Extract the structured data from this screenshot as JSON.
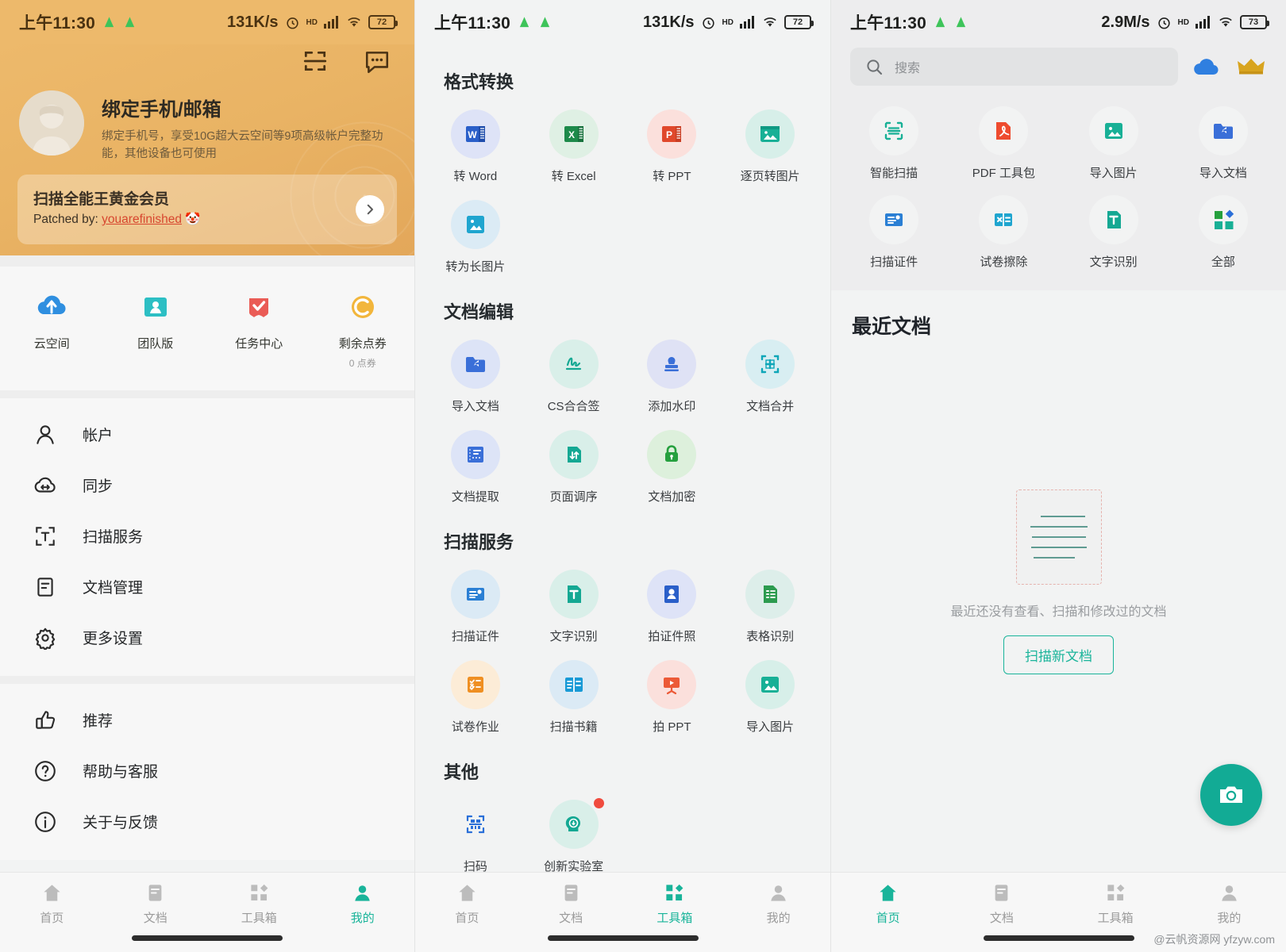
{
  "status_bars": [
    {
      "time": "上午11:30",
      "net_speed": "131K/s",
      "battery": "72",
      "hd": "HD"
    },
    {
      "time": "上午11:30",
      "net_speed": "131K/s",
      "battery": "72",
      "hd": "HD"
    },
    {
      "time": "上午11:30",
      "net_speed": "2.9M/s",
      "battery": "73",
      "hd": "HD"
    }
  ],
  "profile": {
    "scan_icon": "scan-icon",
    "message_icon": "message-icon",
    "name": "绑定手机/邮箱",
    "desc": "绑定手机号，享受10G超大云空间等9项高级帐户完整功能，其他设备也可使用",
    "vip_title": "扫描全能王黄金会员",
    "vip_sub_prefix": "Patched by: ",
    "vip_sub_link": "youarefinished",
    "vip_sub_emoji": "🤡",
    "vip_arrow_icon": "chevron-right-icon",
    "quick": [
      {
        "label": "云空间",
        "icon": "cloud-upload-icon",
        "sub": ""
      },
      {
        "label": "团队版",
        "icon": "team-folder-icon",
        "sub": ""
      },
      {
        "label": "任务中心",
        "icon": "task-check-icon",
        "sub": ""
      },
      {
        "label": "剩余点券",
        "icon": "coin-icon",
        "sub": "0 点券"
      }
    ],
    "menu_group_1": [
      {
        "label": "帐户",
        "icon": "user-icon"
      },
      {
        "label": "同步",
        "icon": "sync-cloud-icon"
      },
      {
        "label": "扫描服务",
        "icon": "scan-text-icon"
      },
      {
        "label": "文档管理",
        "icon": "document-icon"
      },
      {
        "label": "更多设置",
        "icon": "gear-icon"
      }
    ],
    "menu_group_2": [
      {
        "label": "推荐",
        "icon": "thumbs-up-icon"
      },
      {
        "label": "帮助与客服",
        "icon": "question-circle-icon"
      },
      {
        "label": "关于与反馈",
        "icon": "info-circle-icon"
      }
    ]
  },
  "toolbox": {
    "sections": [
      {
        "title": "格式转换",
        "items": [
          {
            "label": "转 Word",
            "icon": "word-icon",
            "bubble": "#dee3f7",
            "badge": false
          },
          {
            "label": "转 Excel",
            "icon": "excel-icon",
            "bubble": "#dff0e4",
            "badge": false
          },
          {
            "label": "转 PPT",
            "icon": "ppt-icon",
            "bubble": "#fbe0dc",
            "badge": false
          },
          {
            "label": "逐页转图片",
            "icon": "image-page-icon",
            "bubble": "#d7efe9",
            "badge": false
          },
          {
            "label": "转为长图片",
            "icon": "long-image-icon",
            "bubble": "#dbebf5",
            "badge": false
          }
        ]
      },
      {
        "title": "文档编辑",
        "items": [
          {
            "label": "导入文档",
            "icon": "import-doc-icon",
            "bubble": "#dde4f7",
            "badge": false
          },
          {
            "label": "CS合合签",
            "icon": "signature-icon",
            "bubble": "#d9efe9",
            "badge": false
          },
          {
            "label": "添加水印",
            "icon": "stamp-icon",
            "bubble": "#dfe2f5",
            "badge": false
          },
          {
            "label": "文档合并",
            "icon": "merge-doc-icon",
            "bubble": "#d8eef2",
            "badge": false
          },
          {
            "label": "文档提取",
            "icon": "extract-doc-icon",
            "bubble": "#dde4f7",
            "badge": false
          },
          {
            "label": "页面调序",
            "icon": "reorder-page-icon",
            "bubble": "#d9efe9",
            "badge": false
          },
          {
            "label": "文档加密",
            "icon": "lock-icon",
            "bubble": "#ddf0dc",
            "badge": false
          }
        ]
      },
      {
        "title": "扫描服务",
        "items": [
          {
            "label": "扫描证件",
            "icon": "id-card-icon",
            "bubble": "#dbeaf5",
            "badge": false
          },
          {
            "label": "文字识别",
            "icon": "ocr-text-icon",
            "bubble": "#d9efe9",
            "badge": false
          },
          {
            "label": "拍证件照",
            "icon": "id-photo-icon",
            "bubble": "#dee3f7",
            "badge": false
          },
          {
            "label": "表格识别",
            "icon": "table-icon",
            "bubble": "#ddeeea",
            "badge": false
          },
          {
            "label": "试卷作业",
            "icon": "exam-icon",
            "bubble": "#fcecd7",
            "badge": false
          },
          {
            "label": "扫描书籍",
            "icon": "book-scan-icon",
            "bubble": "#dbeaf5",
            "badge": false
          },
          {
            "label": "拍 PPT",
            "icon": "ppt-camera-icon",
            "bubble": "#fbe0dc",
            "badge": false
          },
          {
            "label": "导入图片",
            "icon": "import-image-icon",
            "bubble": "#d7efe9",
            "badge": false
          }
        ]
      },
      {
        "title": "其他",
        "items": [
          {
            "label": "扫码",
            "icon": "qrcode-icon",
            "bubble": "transparent",
            "badge": false
          },
          {
            "label": "创新实验室",
            "icon": "lab-brain-icon",
            "bubble": "#d9efe9",
            "badge": true
          }
        ]
      }
    ]
  },
  "home": {
    "search": {
      "placeholder": "搜索",
      "icon": "search-icon"
    },
    "cloud_icon": "cloud-icon",
    "crown_icon": "crown-icon",
    "shortcuts": [
      {
        "label": "智能扫描",
        "icon": "smart-scan-icon"
      },
      {
        "label": "PDF 工具包",
        "icon": "pdf-icon"
      },
      {
        "label": "导入图片",
        "icon": "import-image-icon"
      },
      {
        "label": "导入文档",
        "icon": "import-doc-icon"
      },
      {
        "label": "扫描证件",
        "icon": "id-card-icon"
      },
      {
        "label": "试卷擦除",
        "icon": "exam-erase-icon"
      },
      {
        "label": "文字识别",
        "icon": "ocr-text-icon"
      },
      {
        "label": "全部",
        "icon": "all-grid-icon"
      }
    ],
    "recent_title": "最近文档",
    "empty_text": "最近还没有查看、扫描和修改过的文档",
    "scan_button": "扫描新文档",
    "fab_icon": "camera-icon",
    "watermark": "@云帆资源网 yfzyw.com"
  },
  "tabbars": [
    {
      "active": 3,
      "items": [
        {
          "label": "首页",
          "icon": "home-icon"
        },
        {
          "label": "文档",
          "icon": "document-icon"
        },
        {
          "label": "工具箱",
          "icon": "toolbox-icon"
        },
        {
          "label": "我的",
          "icon": "profile-icon"
        }
      ]
    },
    {
      "active": 2,
      "items": [
        {
          "label": "首页",
          "icon": "home-icon"
        },
        {
          "label": "文档",
          "icon": "document-icon"
        },
        {
          "label": "工具箱",
          "icon": "toolbox-icon"
        },
        {
          "label": "我的",
          "icon": "profile-icon"
        }
      ]
    },
    {
      "active": 0,
      "items": [
        {
          "label": "首页",
          "icon": "home-icon"
        },
        {
          "label": "文档",
          "icon": "document-icon"
        },
        {
          "label": "工具箱",
          "icon": "toolbox-icon"
        },
        {
          "label": "我的",
          "icon": "profile-icon"
        }
      ]
    }
  ],
  "colors": {
    "accent": "#19b49a",
    "gold": "#e9b364",
    "danger": "#f04b3e"
  }
}
